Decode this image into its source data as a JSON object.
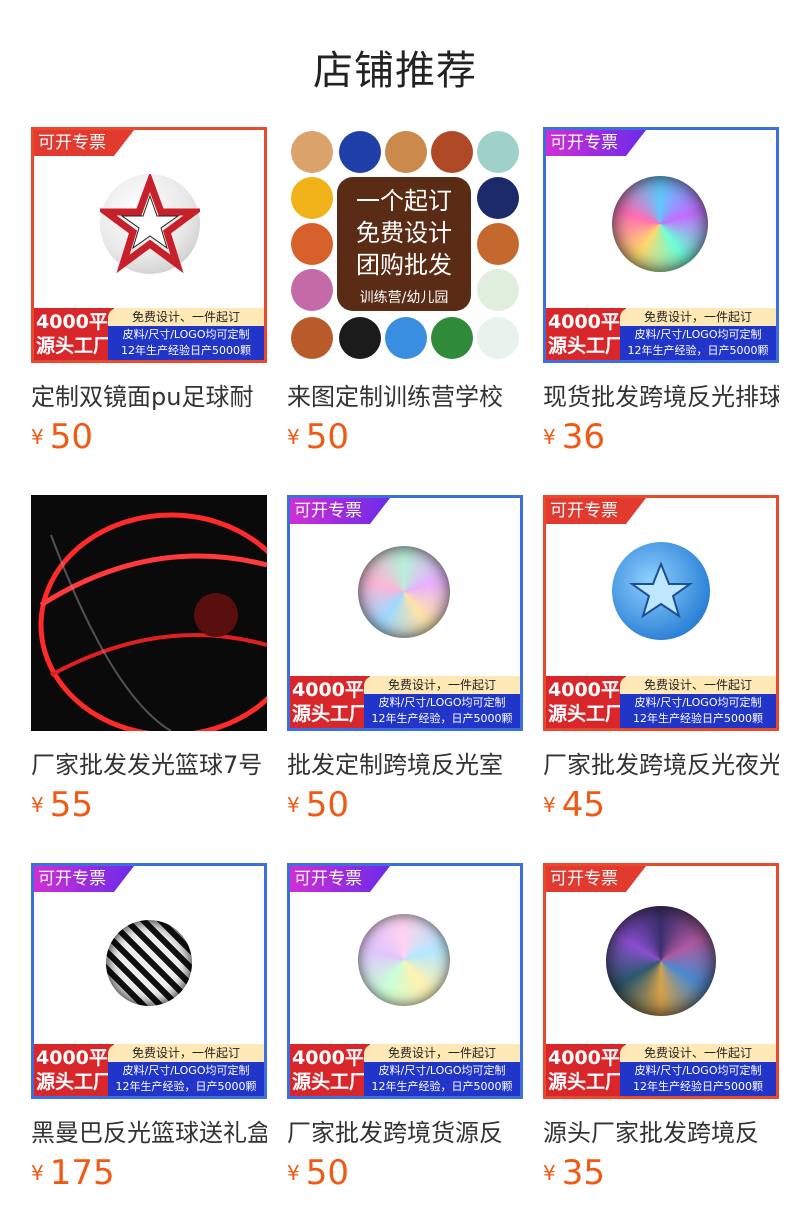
{
  "page": {
    "title": "店铺推荐"
  },
  "overlay": {
    "ribbon": "可开专票",
    "factory_line1": "4000平",
    "factory_line2": "源头工厂",
    "band_top": "免费设计、一件起订",
    "band_top_alt": "免费设计，一件起订",
    "band_mid": "皮料/尺寸/LOGO均可定制",
    "band_bottom": "12年生产经验日产5000颗",
    "band_bottom_alt": "12年生产经验，日产5000颗"
  },
  "collage": {
    "line1": "一个起订",
    "line2": "免费设计",
    "line3": "团购批发",
    "line4": "训练营/幼儿园"
  },
  "products": [
    {
      "name": "定制双镜面pu足球耐",
      "currency": "¥",
      "price": "50"
    },
    {
      "name": "来图定制训练营学校",
      "currency": "¥",
      "price": "50"
    },
    {
      "name": "现货批发跨境反光排球",
      "currency": "¥",
      "price": "36"
    },
    {
      "name": "厂家批发发光篮球7号",
      "currency": "¥",
      "price": "55"
    },
    {
      "name": "批发定制跨境反光室",
      "currency": "¥",
      "price": "50"
    },
    {
      "name": "厂家批发跨境反光夜光",
      "currency": "¥",
      "price": "45"
    },
    {
      "name": "黑曼巴反光篮球送礼盒",
      "currency": "¥",
      "price": "175"
    },
    {
      "name": "厂家批发跨境货源反",
      "currency": "¥",
      "price": "50"
    },
    {
      "name": "源头厂家批发跨境反",
      "currency": "¥",
      "price": "35"
    }
  ]
}
